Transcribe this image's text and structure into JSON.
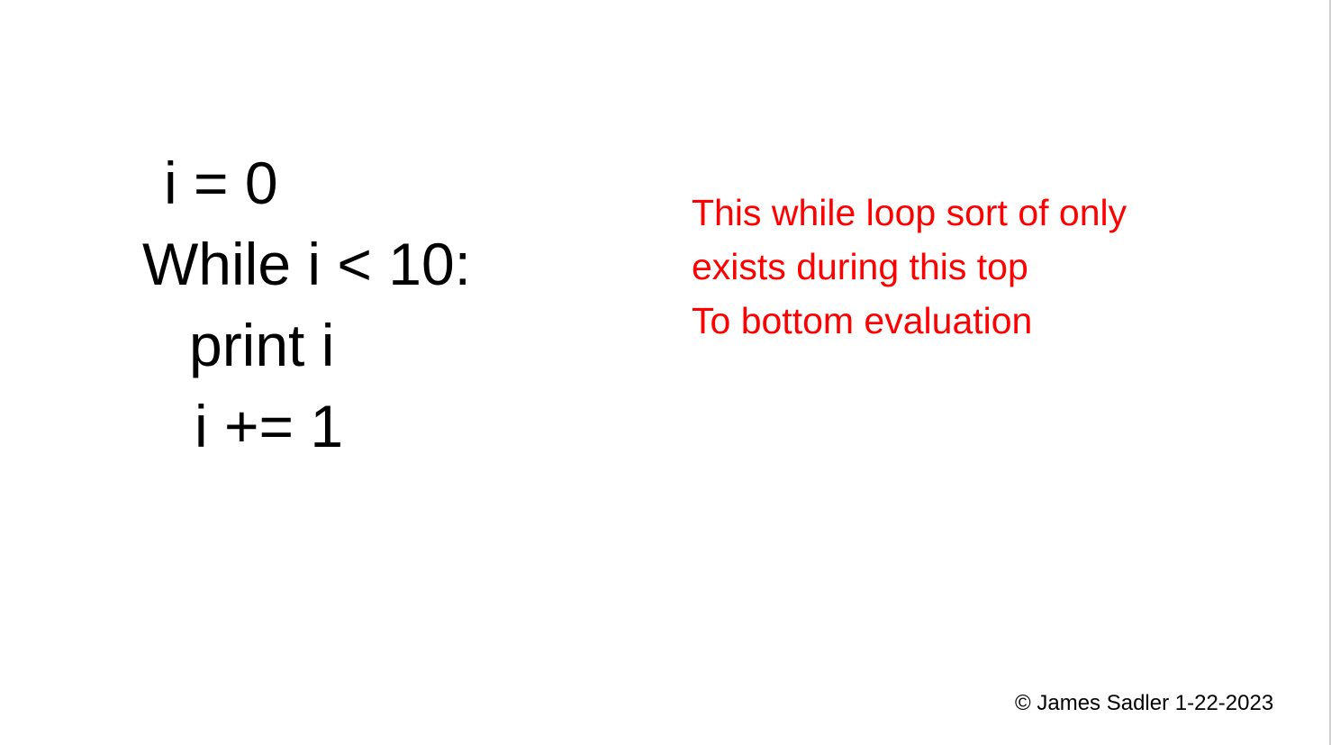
{
  "code": {
    "lines": [
      "i = 0",
      "While i < 10:",
      "print i",
      "i += 1"
    ]
  },
  "note": {
    "lines": [
      "This while loop sort of only",
      "exists during this top",
      "To bottom evaluation"
    ],
    "color": "#ff0000"
  },
  "footer": {
    "copyright": "© James Sadler 1-22-2023"
  }
}
